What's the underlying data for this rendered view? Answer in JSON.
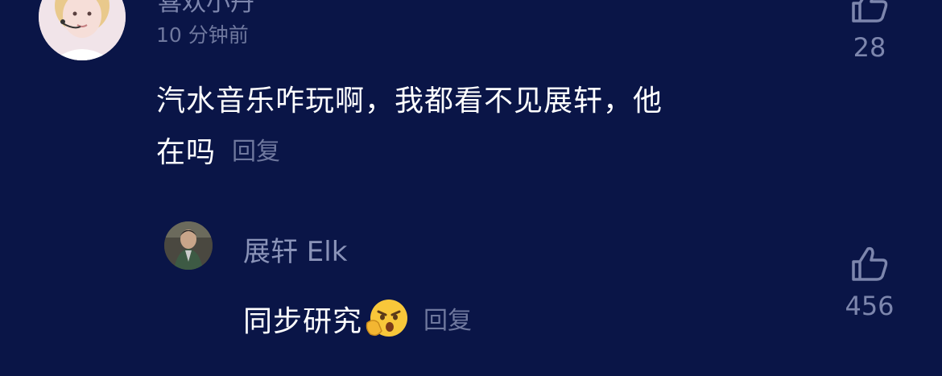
{
  "comments": [
    {
      "username": "喜欢小丹",
      "time": "10 分钟前",
      "text_line1": "汽水音乐咋玩啊，我都看不见展轩，他",
      "text_line2": "在吗",
      "reply_label": "回复",
      "likes": "28",
      "icons": {
        "avatar": "avatar",
        "like": "thumbs-up-icon"
      }
    },
    {
      "username": "展轩 Elk",
      "text": "同步研究",
      "reply_label": "回复",
      "likes": "456",
      "icons": {
        "avatar": "avatar",
        "emoji": "thinking-face-emoji",
        "like": "thumbs-up-icon"
      }
    }
  ],
  "colors": {
    "background": "#0a1547",
    "text": "#ffffff",
    "muted": "#6f789e"
  }
}
